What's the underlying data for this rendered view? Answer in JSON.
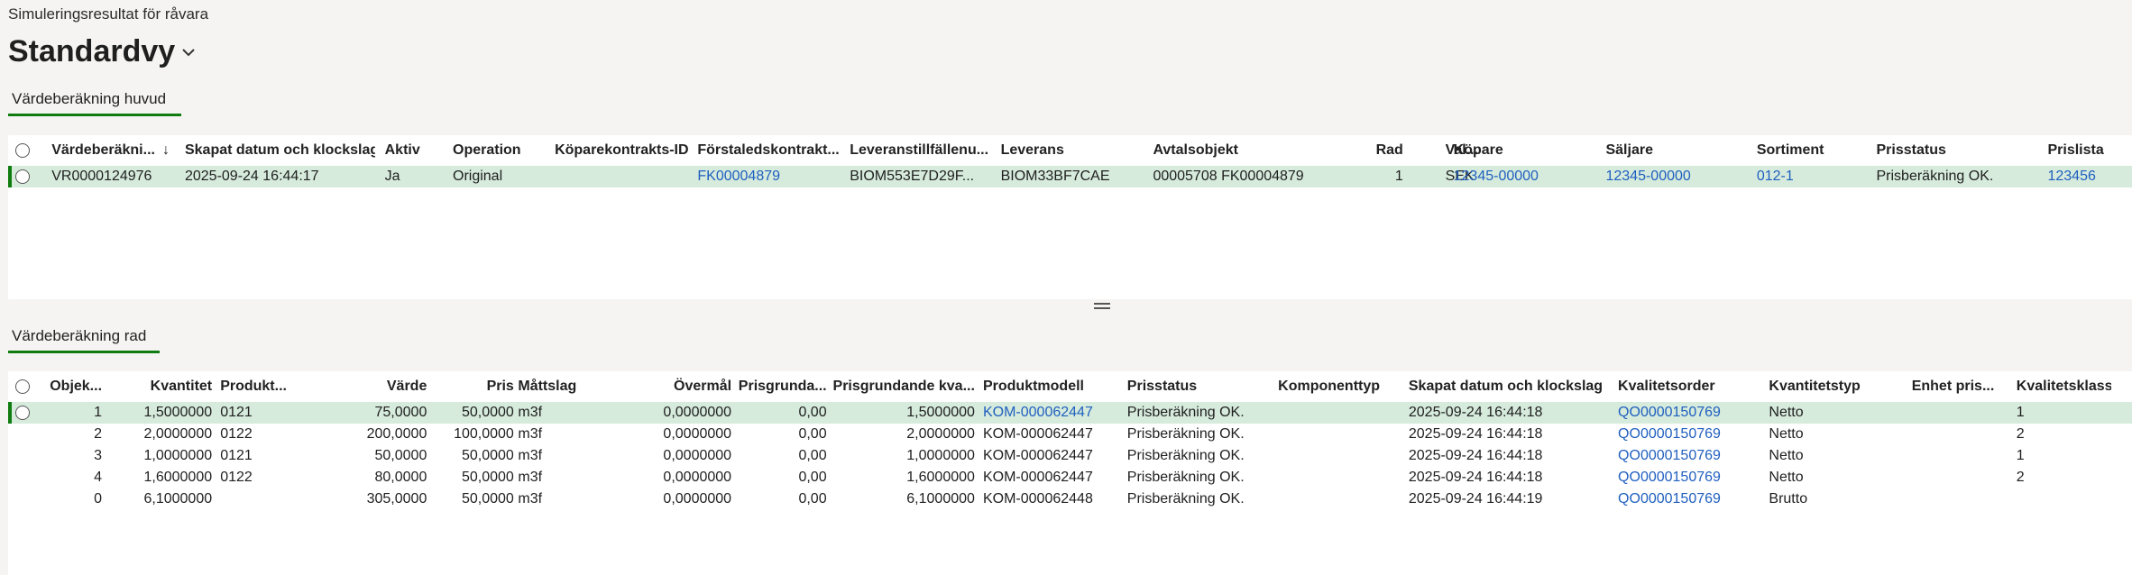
{
  "breadcrumb": "Simuleringsresultat för råvara",
  "view_title": "Standardvy",
  "tab_header": "Värdeberäkning huvud",
  "tab_lines": "Värdeberäkning rad",
  "header_grid": {
    "columns": [
      "Värdeberäkni...",
      "Skapat datum och klockslag",
      "Aktiv",
      "Operation",
      "Köparekontrakts-ID",
      "Förstaledskontrakt...",
      "Leveranstillfällenu...",
      "Leverans",
      "Avtalsobjekt",
      "Rad",
      "Val...",
      "Köpare",
      "Säljare",
      "Sortiment",
      "Prisstatus",
      "Prislista"
    ],
    "sort_icon": "arrow-down-icon",
    "rows": [
      [
        "VR0000124976",
        "2025-09-24 16:44:17",
        "Ja",
        "Original",
        "",
        "FK00004879",
        "BIOM553E7D29F...",
        "BIOM33BF7CAE",
        "00005708    FK00004879",
        "1",
        "SEK",
        "12345-00000",
        "12345-00000",
        "012-1",
        "Prisberäkning OK.",
        "123456"
      ]
    ]
  },
  "line_grid": {
    "columns": [
      "Objek...",
      "Kvantitet",
      "Produkt...",
      "Värde",
      "Pris",
      "Måttslag",
      "Övermål",
      "Prisgrunda...",
      "Prisgrundande kva...",
      "Produktmodell",
      "Prisstatus",
      "Komponenttyp",
      "Skapat datum och klockslag",
      "Kvalitetsorder",
      "Kvantitetstyp",
      "Enhet pris...",
      "Kvalitetsklass"
    ],
    "rows": [
      [
        "1",
        "1,5000000",
        "0121",
        "75,0000",
        "50,0000",
        "m3f",
        "0,0000000",
        "0,00",
        "1,5000000",
        "KOM-000062447",
        "Prisberäkning OK.",
        "",
        "2025-09-24 16:44:18",
        "QO0000150769",
        "Netto",
        "",
        "1"
      ],
      [
        "2",
        "2,0000000",
        "0122",
        "200,0000",
        "100,0000",
        "m3f",
        "0,0000000",
        "0,00",
        "2,0000000",
        "KOM-000062447",
        "Prisberäkning OK.",
        "",
        "2025-09-24 16:44:18",
        "QO0000150769",
        "Netto",
        "",
        "2"
      ],
      [
        "3",
        "1,0000000",
        "0121",
        "50,0000",
        "50,0000",
        "m3f",
        "0,0000000",
        "0,00",
        "1,0000000",
        "KOM-000062447",
        "Prisberäkning OK.",
        "",
        "2025-09-24 16:44:18",
        "QO0000150769",
        "Netto",
        "",
        "1"
      ],
      [
        "4",
        "1,6000000",
        "0122",
        "80,0000",
        "50,0000",
        "m3f",
        "0,0000000",
        "0,00",
        "1,6000000",
        "KOM-000062447",
        "Prisberäkning OK.",
        "",
        "2025-09-24 16:44:18",
        "QO0000150769",
        "Netto",
        "",
        "2"
      ],
      [
        "0",
        "6,1000000",
        "",
        "305,0000",
        "50,0000",
        "m3f",
        "0,0000000",
        "0,00",
        "6,1000000",
        "KOM-000062448",
        "Prisberäkning OK.",
        "",
        "2025-09-24 16:44:19",
        "QO0000150769",
        "Brutto",
        "",
        ""
      ]
    ]
  },
  "colors": {
    "accent": "#107c10",
    "selected_row": "#d6ebdc",
    "link": "#1f5fbf"
  }
}
